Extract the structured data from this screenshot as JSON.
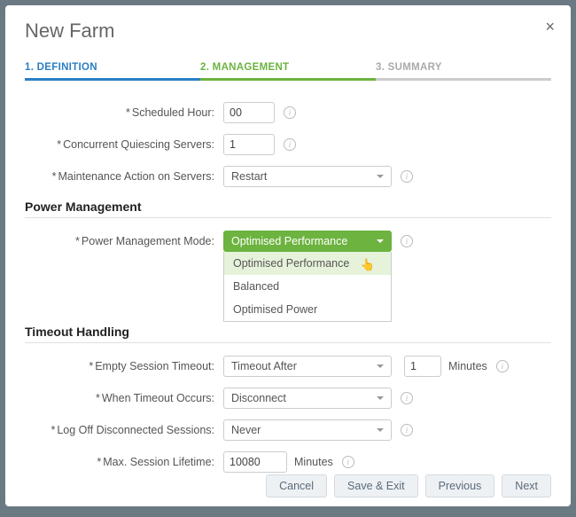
{
  "title": "New Farm",
  "tabs": {
    "t1": "1. DEFINITION",
    "t2": "2. MANAGEMENT",
    "t3": "3. SUMMARY"
  },
  "labels": {
    "scheduledHour": "Scheduled Hour:",
    "concurrent": "Concurrent Quiescing Servers:",
    "maintAction": "Maintenance Action on Servers:",
    "powerMode": "Power Management Mode:",
    "emptySession": "Empty Session Timeout:",
    "whenTimeout": "When Timeout Occurs:",
    "logoff": "Log Off Disconnected Sessions:",
    "maxLifetime": "Max. Session Lifetime:"
  },
  "values": {
    "scheduledHour": "00",
    "concurrent": "1",
    "maintAction": "Restart",
    "powerModeSelected": "Optimised Performance",
    "emptySession": "Timeout After",
    "emptySessionNum": "1",
    "whenTimeout": "Disconnect",
    "logoff": "Never",
    "maxLifetime": "10080"
  },
  "dropdown": {
    "opt1": "Optimised Performance",
    "opt2": "Balanced",
    "opt3": "Optimised Power"
  },
  "sections": {
    "power": "Power Management",
    "timeout": "Timeout Handling"
  },
  "units": {
    "minutes": "Minutes"
  },
  "buttons": {
    "cancel": "Cancel",
    "saveExit": "Save & Exit",
    "previous": "Previous",
    "next": "Next"
  },
  "info_char": "i"
}
